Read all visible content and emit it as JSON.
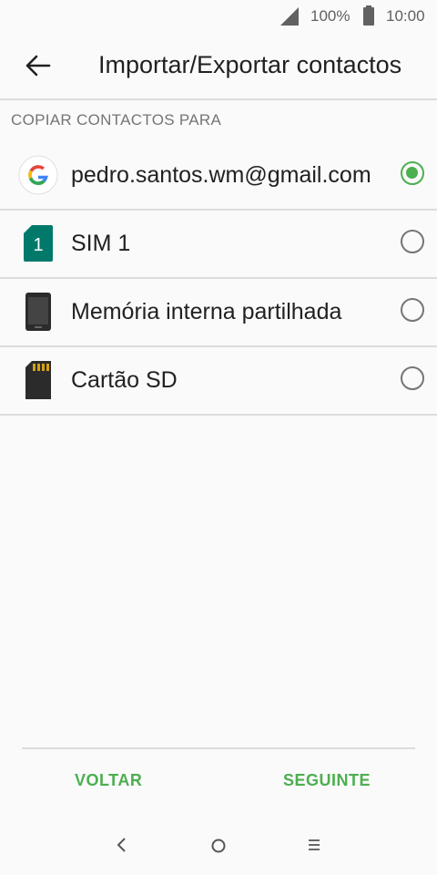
{
  "status_bar": {
    "battery_percent": "100%",
    "time": "10:00"
  },
  "toolbar": {
    "title": "Importar/Exportar contactos"
  },
  "section": {
    "header": "COPIAR CONTACTOS PARA"
  },
  "options": [
    {
      "label": "pedro.santos.wm@gmail.com",
      "icon": "google-icon",
      "selected": true
    },
    {
      "label": "SIM 1",
      "icon": "sim-card-icon",
      "sim_number": "1",
      "selected": false
    },
    {
      "label": "Memória interna partilhada",
      "icon": "phone-icon",
      "selected": false
    },
    {
      "label": "Cartão SD",
      "icon": "sd-card-icon",
      "selected": false
    }
  ],
  "actions": {
    "back_label": "VOLTAR",
    "next_label": "SEGUINTE"
  },
  "colors": {
    "accent": "#4caf50",
    "sim": "#00796b",
    "text": "#212121",
    "secondary": "#757575"
  }
}
